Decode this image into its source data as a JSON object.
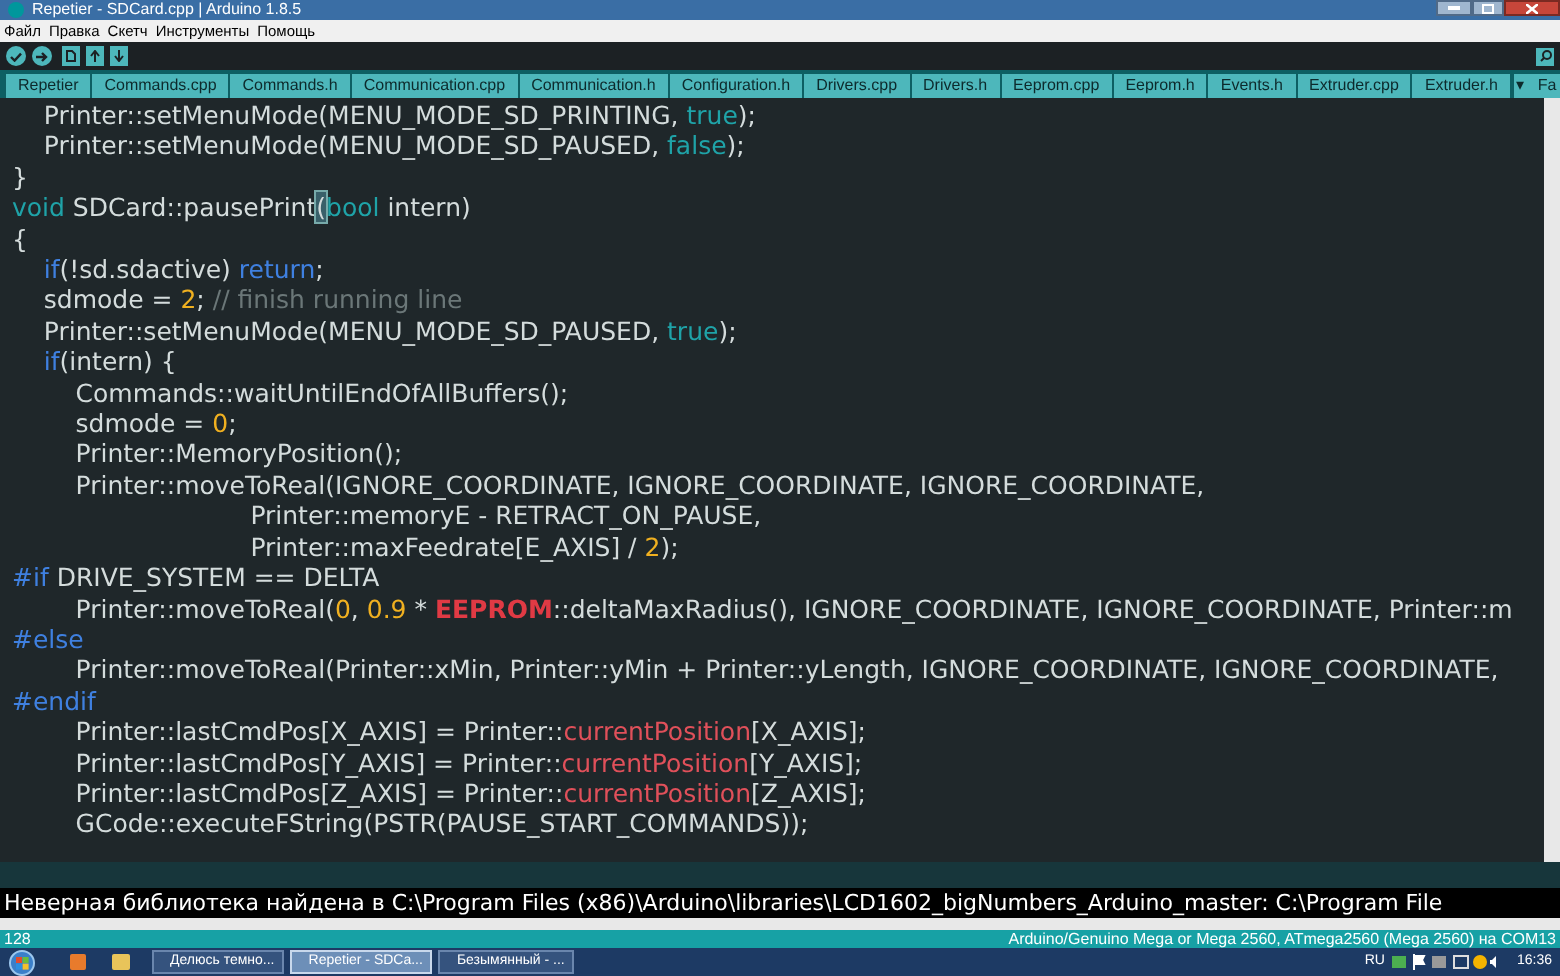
{
  "window": {
    "title": "Repetier - SDCard.cpp | Arduino 1.8.5"
  },
  "menu": [
    "Файл",
    "Правка",
    "Скетч",
    "Инструменты",
    "Помощь"
  ],
  "tabs": [
    {
      "label": "Repetier",
      "selected": false
    },
    {
      "label": "Commands.cpp",
      "selected": false
    },
    {
      "label": "Commands.h",
      "selected": false
    },
    {
      "label": "Communication.cpp",
      "selected": false
    },
    {
      "label": "Communication.h",
      "selected": false
    },
    {
      "label": "Configuration.h",
      "selected": false
    },
    {
      "label": "Drivers.cpp",
      "selected": false
    },
    {
      "label": "Drivers.h",
      "selected": false
    },
    {
      "label": "Eeprom.cpp",
      "selected": false
    },
    {
      "label": "Eeprom.h",
      "selected": false
    },
    {
      "label": "Events.h",
      "selected": false
    },
    {
      "label": "Extruder.cpp",
      "selected": false
    },
    {
      "label": "Extruder.h",
      "selected": false
    },
    {
      "label": "Fa",
      "selected": false
    }
  ],
  "tab_menu": "▾",
  "code_lines": [
    [
      {
        "kind": "plain",
        "text": "    Printer::setMenuMode(MENU_MODE_SD_PRINTING, "
      },
      {
        "kind": "type",
        "text": "true"
      },
      {
        "kind": "plain",
        "text": ");"
      }
    ],
    [
      {
        "kind": "plain",
        "text": "    Printer::setMenuMode(MENU_MODE_SD_PAUSED, "
      },
      {
        "kind": "type",
        "text": "false"
      },
      {
        "kind": "plain",
        "text": ");"
      }
    ],
    [
      {
        "kind": "plain",
        "text": "}"
      }
    ],
    [
      {
        "kind": "type",
        "text": "void"
      },
      {
        "kind": "plain",
        "text": " SDCard::pausePrint"
      },
      {
        "kind": "match",
        "text": "("
      },
      {
        "kind": "type",
        "text": "bool"
      },
      {
        "kind": "plain",
        "text": " intern)"
      }
    ],
    [
      {
        "kind": "plain",
        "text": "{"
      }
    ],
    [
      {
        "kind": "control",
        "text": "    if"
      },
      {
        "kind": "plain",
        "text": "(!sd.sdactive) "
      },
      {
        "kind": "control",
        "text": "return"
      },
      {
        "kind": "plain",
        "text": ";"
      }
    ],
    [
      {
        "kind": "plain",
        "text": "    sdmode = "
      },
      {
        "kind": "number",
        "text": "2"
      },
      {
        "kind": "plain",
        "text": "; "
      },
      {
        "kind": "comment",
        "text": "// finish running line"
      }
    ],
    [
      {
        "kind": "plain",
        "text": "    Printer::setMenuMode(MENU_MODE_SD_PAUSED, "
      },
      {
        "kind": "type",
        "text": "true"
      },
      {
        "kind": "plain",
        "text": ");"
      }
    ],
    [
      {
        "kind": "control",
        "text": "    if"
      },
      {
        "kind": "plain",
        "text": "(intern) {"
      }
    ],
    [
      {
        "kind": "plain",
        "text": "        Commands::waitUntilEndOfAllBuffers();"
      }
    ],
    [
      {
        "kind": "plain",
        "text": "        sdmode = "
      },
      {
        "kind": "number",
        "text": "0"
      },
      {
        "kind": "plain",
        "text": ";"
      }
    ],
    [
      {
        "kind": "plain",
        "text": "        Printer::MemoryPosition();"
      }
    ],
    [
      {
        "kind": "plain",
        "text": "        Printer::moveToReal(IGNORE_COORDINATE, IGNORE_COORDINATE, IGNORE_COORDINATE,"
      }
    ],
    [
      {
        "kind": "plain",
        "text": "                              Printer::memoryE - RETRACT_ON_PAUSE,"
      }
    ],
    [
      {
        "kind": "plain",
        "text": "                              Printer::maxFeedrate[E_AXIS] / "
      },
      {
        "kind": "number",
        "text": "2"
      },
      {
        "kind": "plain",
        "text": ");"
      }
    ],
    [
      {
        "kind": "control",
        "text": "#if"
      },
      {
        "kind": "plain",
        "text": " DRIVE_SYSTEM == DELTA"
      }
    ],
    [
      {
        "kind": "plain",
        "text": "        Printer::moveToReal("
      },
      {
        "kind": "number",
        "text": "0"
      },
      {
        "kind": "plain",
        "text": ", "
      },
      {
        "kind": "number",
        "text": "0.9"
      },
      {
        "kind": "plain",
        "text": " * "
      },
      {
        "kind": "strong",
        "text": "EEPROM"
      },
      {
        "kind": "plain",
        "text": "::deltaMaxRadius(), IGNORE_COORDINATE, IGNORE_COORDINATE, Printer::m"
      }
    ],
    [
      {
        "kind": "control",
        "text": "#else"
      }
    ],
    [
      {
        "kind": "plain",
        "text": "        Printer::moveToReal(Printer::xMin, Printer::yMin + Printer::yLength, IGNORE_COORDINATE, IGNORE_COORDINATE,"
      }
    ],
    [
      {
        "kind": "control",
        "text": "#endif"
      }
    ],
    [
      {
        "kind": "plain",
        "text": "        Printer::lastCmdPos[X_AXIS] = Printer::"
      },
      {
        "kind": "red",
        "text": "currentPosition"
      },
      {
        "kind": "plain",
        "text": "[X_AXIS];"
      }
    ],
    [
      {
        "kind": "plain",
        "text": "        Printer::lastCmdPos[Y_AXIS] = Printer::"
      },
      {
        "kind": "red",
        "text": "currentPosition"
      },
      {
        "kind": "plain",
        "text": "[Y_AXIS];"
      }
    ],
    [
      {
        "kind": "plain",
        "text": "        Printer::lastCmdPos[Z_AXIS] = Printer::"
      },
      {
        "kind": "red",
        "text": "currentPosition"
      },
      {
        "kind": "plain",
        "text": "[Z_AXIS];"
      }
    ],
    [
      {
        "kind": "plain",
        "text": "        GCode::executeFString(PSTR(PAUSE_START_COMMANDS));"
      }
    ]
  ],
  "console_text": "Неверная библиотека найдена в C:\\Program Files (x86)\\Arduino\\libraries\\LCD1602_bigNumbers_Arduino_master: C:\\Program File",
  "status_bar": {
    "line": "128",
    "board": "Arduino/Genuino Mega or Mega 2560, ATmega2560 (Mega 2560) на COM13"
  },
  "taskbar": {
    "tasks": [
      {
        "label": "Делюсь темно...",
        "selected": false
      },
      {
        "label": "Repetier - SDCa...",
        "selected": true
      },
      {
        "label": "Безымянный - ...",
        "selected": false
      }
    ],
    "language": "RU",
    "clock": "16:36"
  }
}
